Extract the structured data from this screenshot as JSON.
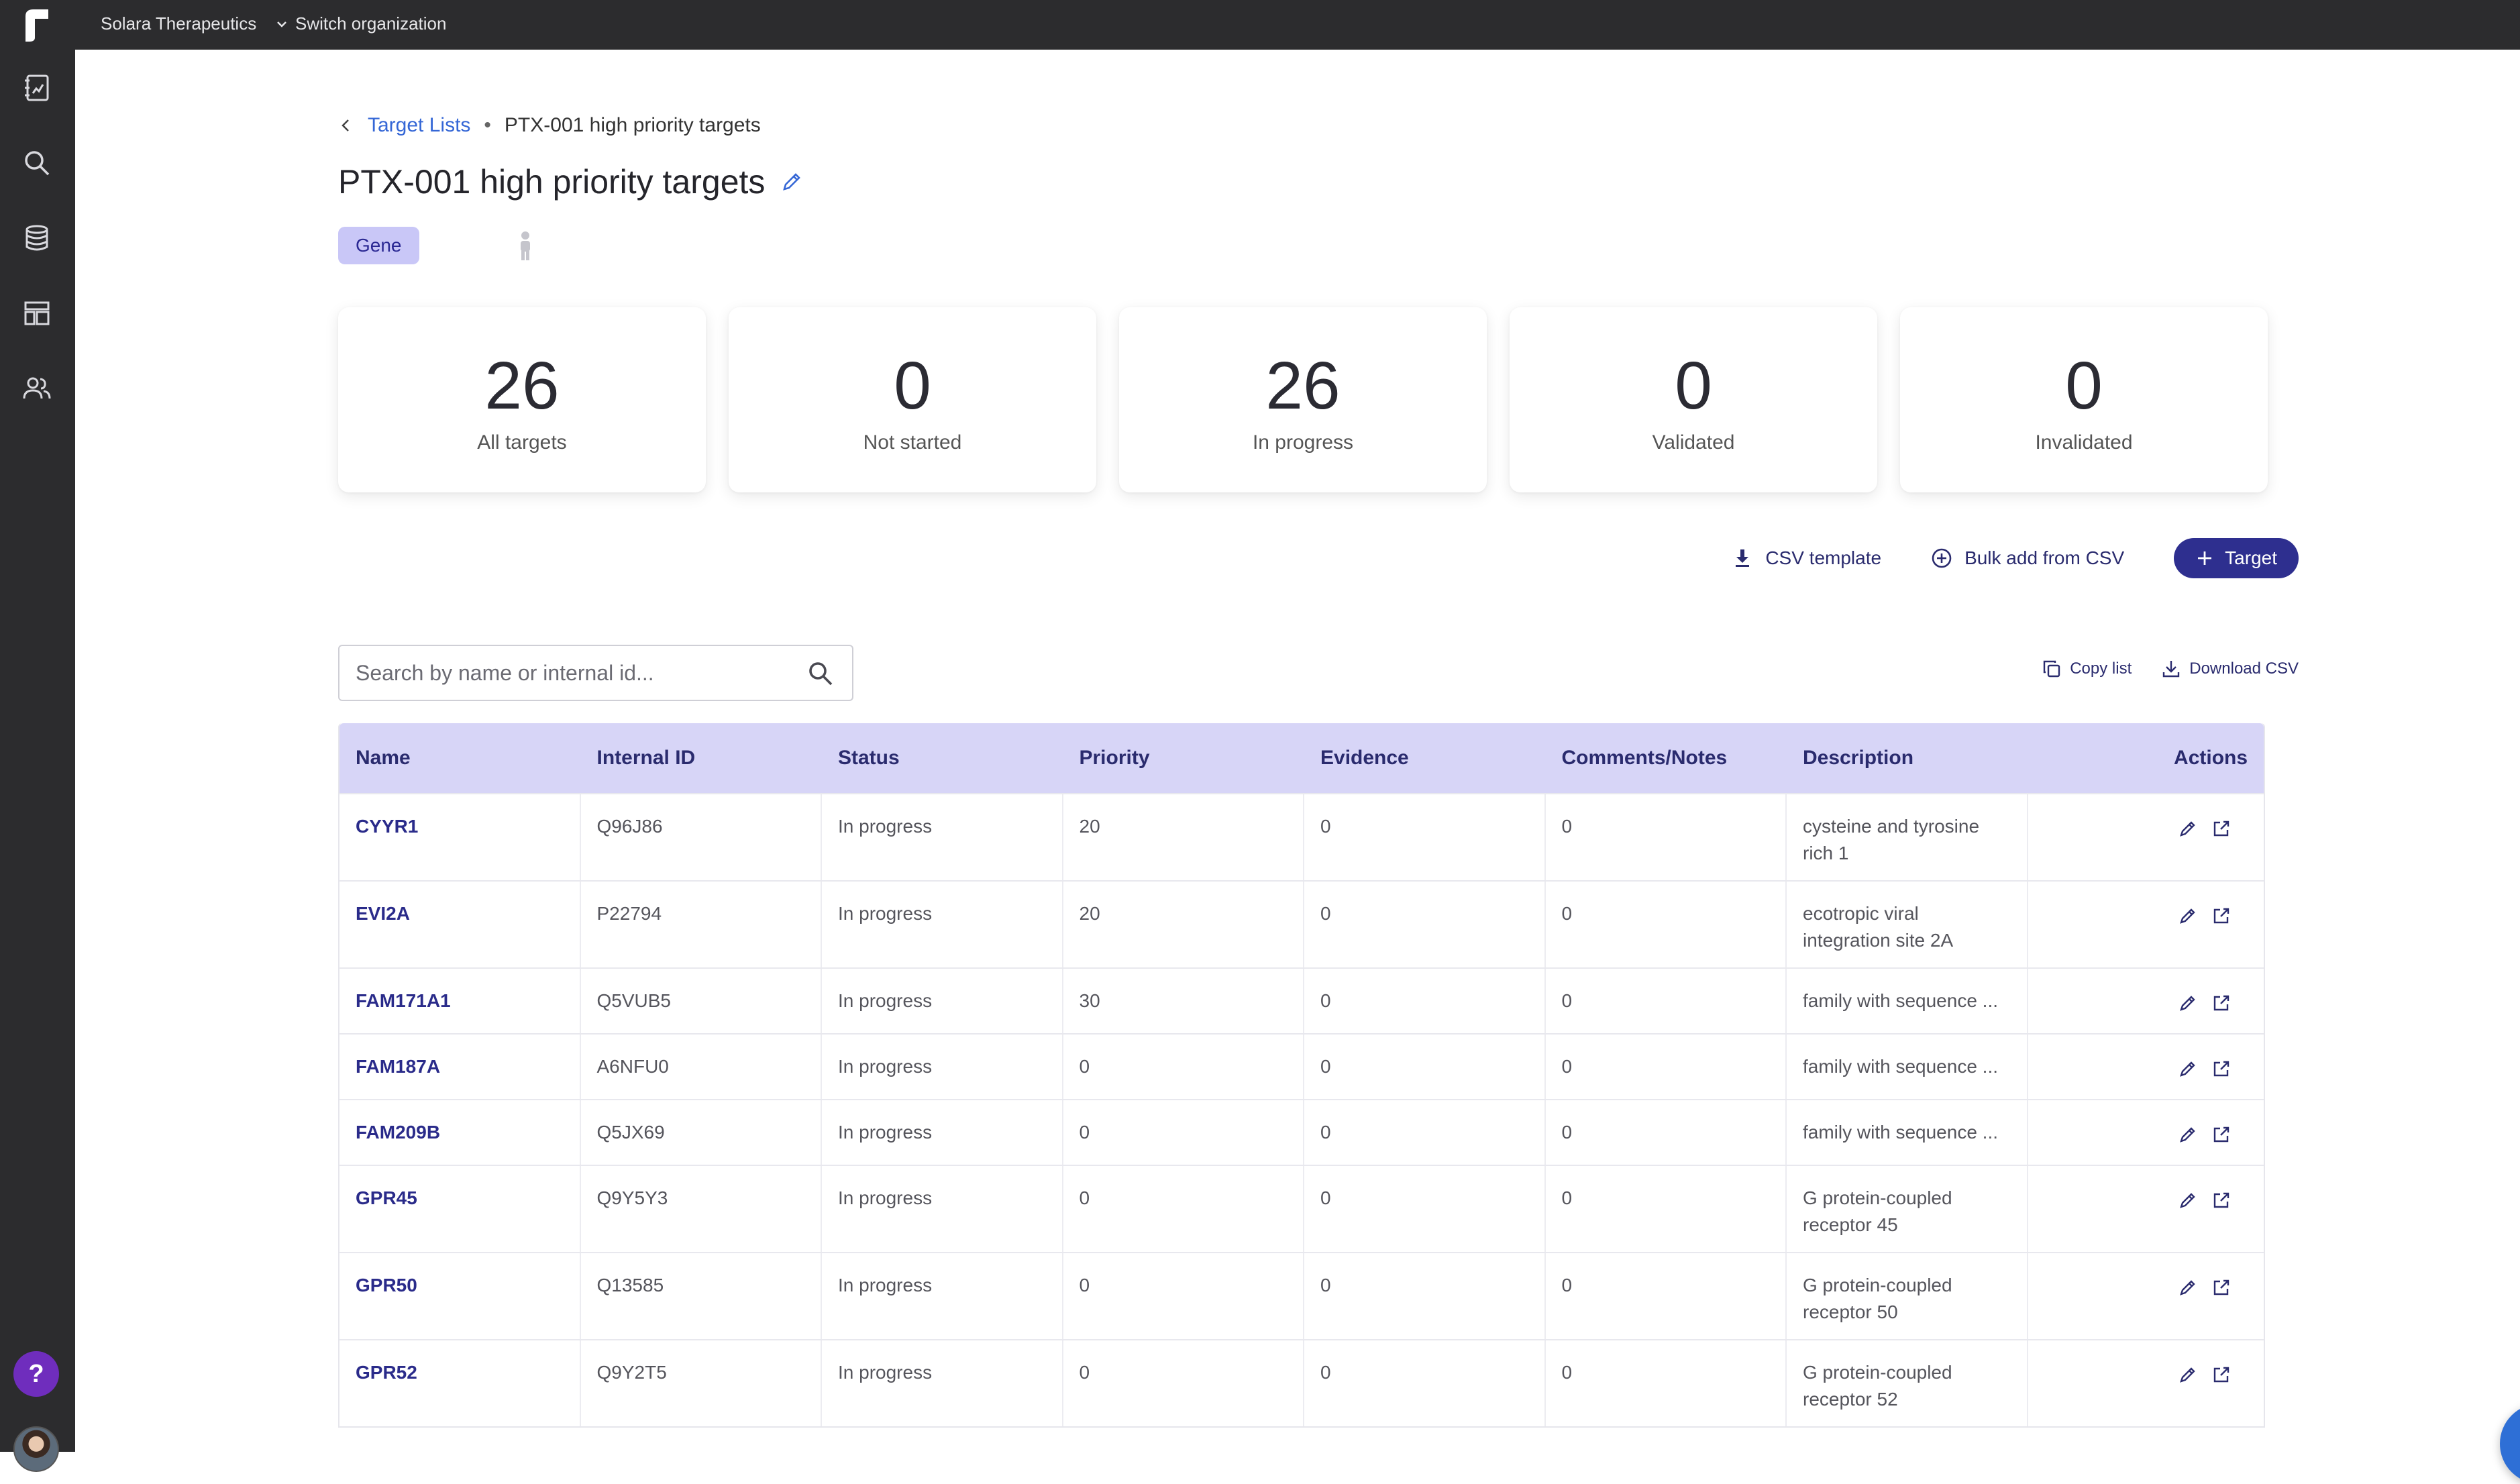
{
  "topbar": {
    "org_name": "Solara Therapeutics",
    "switch_org_label": "Switch organization"
  },
  "sidebar": {
    "items": [
      {
        "icon": "notebook-icon"
      },
      {
        "icon": "search-icon"
      },
      {
        "icon": "database-icon"
      },
      {
        "icon": "layout-icon"
      },
      {
        "icon": "users-icon"
      }
    ],
    "help_label": "?"
  },
  "breadcrumb": {
    "parent": "Target Lists",
    "separator": "•",
    "current": "PTX-001 high priority targets"
  },
  "page": {
    "title": "PTX-001 high priority targets",
    "tag": "Gene"
  },
  "stats": [
    {
      "value": "26",
      "label": "All targets"
    },
    {
      "value": "0",
      "label": "Not started"
    },
    {
      "value": "26",
      "label": "In progress"
    },
    {
      "value": "0",
      "label": "Validated"
    },
    {
      "value": "0",
      "label": "Invalidated"
    }
  ],
  "actions": {
    "csv_template": "CSV template",
    "bulk_add": "Bulk add from CSV",
    "add_target": "Target"
  },
  "search": {
    "placeholder": "Search by name or internal id..."
  },
  "list_tools": {
    "copy_list": "Copy list",
    "download_csv": "Download CSV"
  },
  "table": {
    "columns": [
      "Name",
      "Internal ID",
      "Status",
      "Priority",
      "Evidence",
      "Comments/Notes",
      "Description",
      "Actions"
    ],
    "rows": [
      {
        "name": "CYYR1",
        "id": "Q96J86",
        "status": "In progress",
        "priority": "20",
        "evidence": "0",
        "comments": "0",
        "description": "cysteine and tyrosine rich 1"
      },
      {
        "name": "EVI2A",
        "id": "P22794",
        "status": "In progress",
        "priority": "20",
        "evidence": "0",
        "comments": "0",
        "description": "ecotropic viral integration site 2A"
      },
      {
        "name": "FAM171A1",
        "id": "Q5VUB5",
        "status": "In progress",
        "priority": "30",
        "evidence": "0",
        "comments": "0",
        "description": "family with sequence ..."
      },
      {
        "name": "FAM187A",
        "id": "A6NFU0",
        "status": "In progress",
        "priority": "0",
        "evidence": "0",
        "comments": "0",
        "description": "family with sequence ..."
      },
      {
        "name": "FAM209B",
        "id": "Q5JX69",
        "status": "In progress",
        "priority": "0",
        "evidence": "0",
        "comments": "0",
        "description": "family with sequence ..."
      },
      {
        "name": "GPR45",
        "id": "Q9Y5Y3",
        "status": "In progress",
        "priority": "0",
        "evidence": "0",
        "comments": "0",
        "description": "G protein-coupled receptor 45"
      },
      {
        "name": "GPR50",
        "id": "Q13585",
        "status": "In progress",
        "priority": "0",
        "evidence": "0",
        "comments": "0",
        "description": "G protein-coupled receptor 50"
      },
      {
        "name": "GPR52",
        "id": "Q9Y2T5",
        "status": "In progress",
        "priority": "0",
        "evidence": "0",
        "comments": "0",
        "description": "G protein-coupled receptor 52"
      }
    ]
  },
  "colors": {
    "accent": "#2e2f8f",
    "link": "#3567d6",
    "header_bg": "#d7d5f7",
    "sidebar_bg": "#2c2c2e",
    "tag_bg": "#c9c7f7"
  }
}
